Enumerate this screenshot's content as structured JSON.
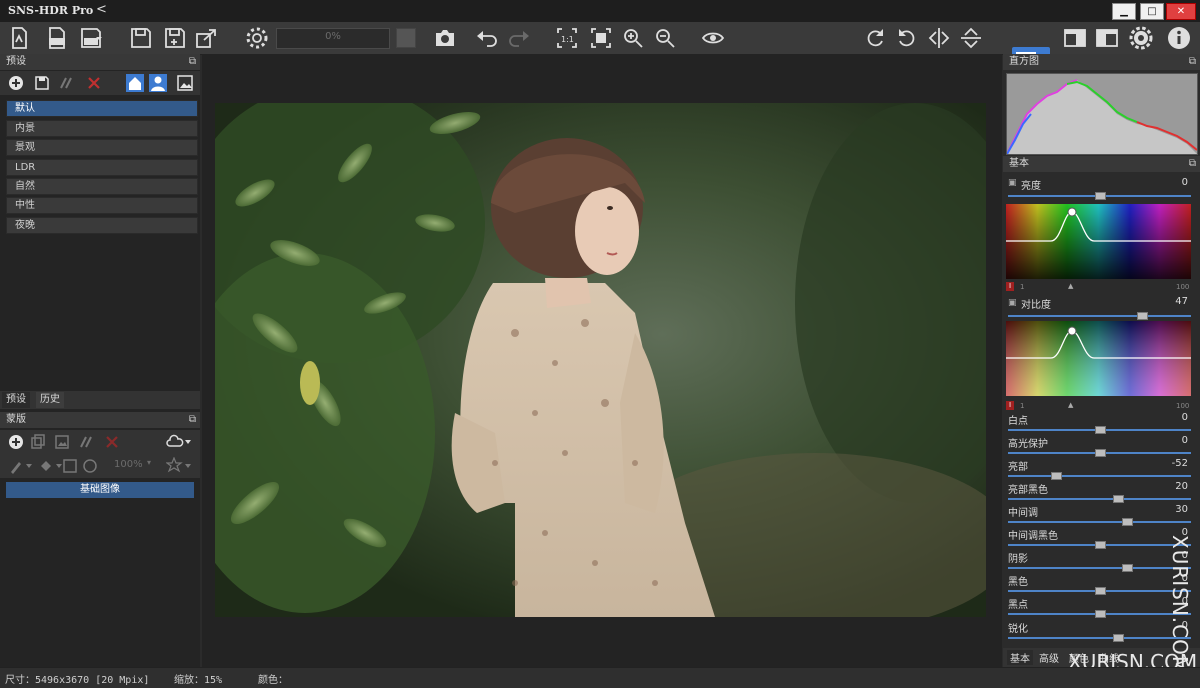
{
  "app": {
    "title": "SNS-HDR Pro",
    "collapse_glyph": "<"
  },
  "window_controls": {
    "minimize": "▁",
    "maximize": "□",
    "close": "✕"
  },
  "toolbar": {
    "progress": "0%",
    "progress_value": 0
  },
  "left_panel": {
    "presets_title": "预设",
    "presets": [
      {
        "label": "默认",
        "selected": true
      },
      {
        "label": "内景",
        "selected": false
      },
      {
        "label": "景观",
        "selected": false
      },
      {
        "label": "LDR",
        "selected": false
      },
      {
        "label": "自然",
        "selected": false
      },
      {
        "label": "中性",
        "selected": false
      },
      {
        "label": "夜晚",
        "selected": false
      }
    ],
    "tabs": [
      "预设",
      "历史"
    ],
    "masks_title": "蒙版",
    "mask_opacity": "100%",
    "base_image": "基础图像"
  },
  "right_panel": {
    "histogram_title": "直方图",
    "basic_title": "基本",
    "brightness": {
      "label": "亮度",
      "value": "0",
      "level": 0.5
    },
    "contrast": {
      "label": "对比度",
      "value": "47",
      "level": 0.73
    },
    "curve_axis": {
      "min": "1",
      "max": "100"
    },
    "adjustments": [
      {
        "label": "白点",
        "value": "0",
        "level": 0.5
      },
      {
        "label": "高光保护",
        "value": "0",
        "level": 0.5
      },
      {
        "label": "亮部",
        "value": "-52",
        "level": 0.26
      },
      {
        "label": "亮部黑色",
        "value": "20",
        "level": 0.6
      },
      {
        "label": "中间调",
        "value": "30",
        "level": 0.65
      },
      {
        "label": "中间调黑色",
        "value": "0",
        "level": 0.5
      },
      {
        "label": "阴影",
        "value": "0",
        "level": 0.65
      },
      {
        "label": "黑色",
        "value": "0",
        "level": 0.5
      },
      {
        "label": "黑点",
        "value": "0",
        "level": 0.5
      },
      {
        "label": "锐化",
        "value": "0",
        "level": 0.6
      }
    ],
    "tabs": [
      "基本",
      "高级",
      "颜色",
      "曲线"
    ]
  },
  "status": {
    "size": "尺寸：5496x3670 [20 Mpix]",
    "zoom": "缩放：15%",
    "color": "颜色："
  },
  "watermark": {
    "side": "XURISN.COM",
    "bottom": "XURISN.COM"
  },
  "colors": {
    "accent": "#3d7bd1",
    "selected": "#335a8a",
    "panel": "#2b2b2b"
  }
}
